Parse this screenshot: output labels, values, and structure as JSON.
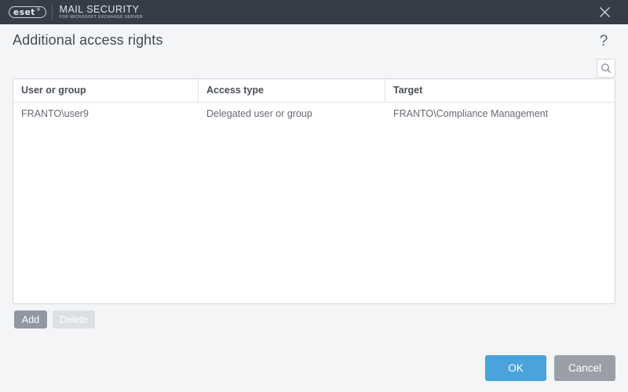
{
  "titlebar": {
    "logo_mark": "eset",
    "logo_tm": "®",
    "product_name": "MAIL SECURITY",
    "product_subtitle": "FOR MICROSOFT EXCHANGE SERVER",
    "close_icon": "close-icon"
  },
  "header": {
    "title": "Additional access rights",
    "help_label": "?",
    "help_icon": "question-mark-icon"
  },
  "toolbar": {
    "search_icon": "search-icon"
  },
  "table": {
    "columns": [
      {
        "label": "User or group"
      },
      {
        "label": "Access type"
      },
      {
        "label": "Target"
      }
    ],
    "rows": [
      {
        "user_or_group": "FRANTO\\user9",
        "access_type": "Delegated user or group",
        "target": "FRANTO\\Compliance Management"
      }
    ]
  },
  "row_actions": {
    "add_label": "Add",
    "delete_label": "Delete",
    "add_state": "enabled",
    "delete_state": "disabled"
  },
  "footer": {
    "ok_label": "OK",
    "cancel_label": "Cancel"
  },
  "colors": {
    "titlebar": "#373d48",
    "page_background": "#f4f5f7",
    "accent_primary": "#4aa3da",
    "cancel_gray": "#9ba0a8",
    "add_gray": "#9198a3",
    "disabled_gray": "#dcdfe4",
    "table_border": "#d4d7dc"
  }
}
